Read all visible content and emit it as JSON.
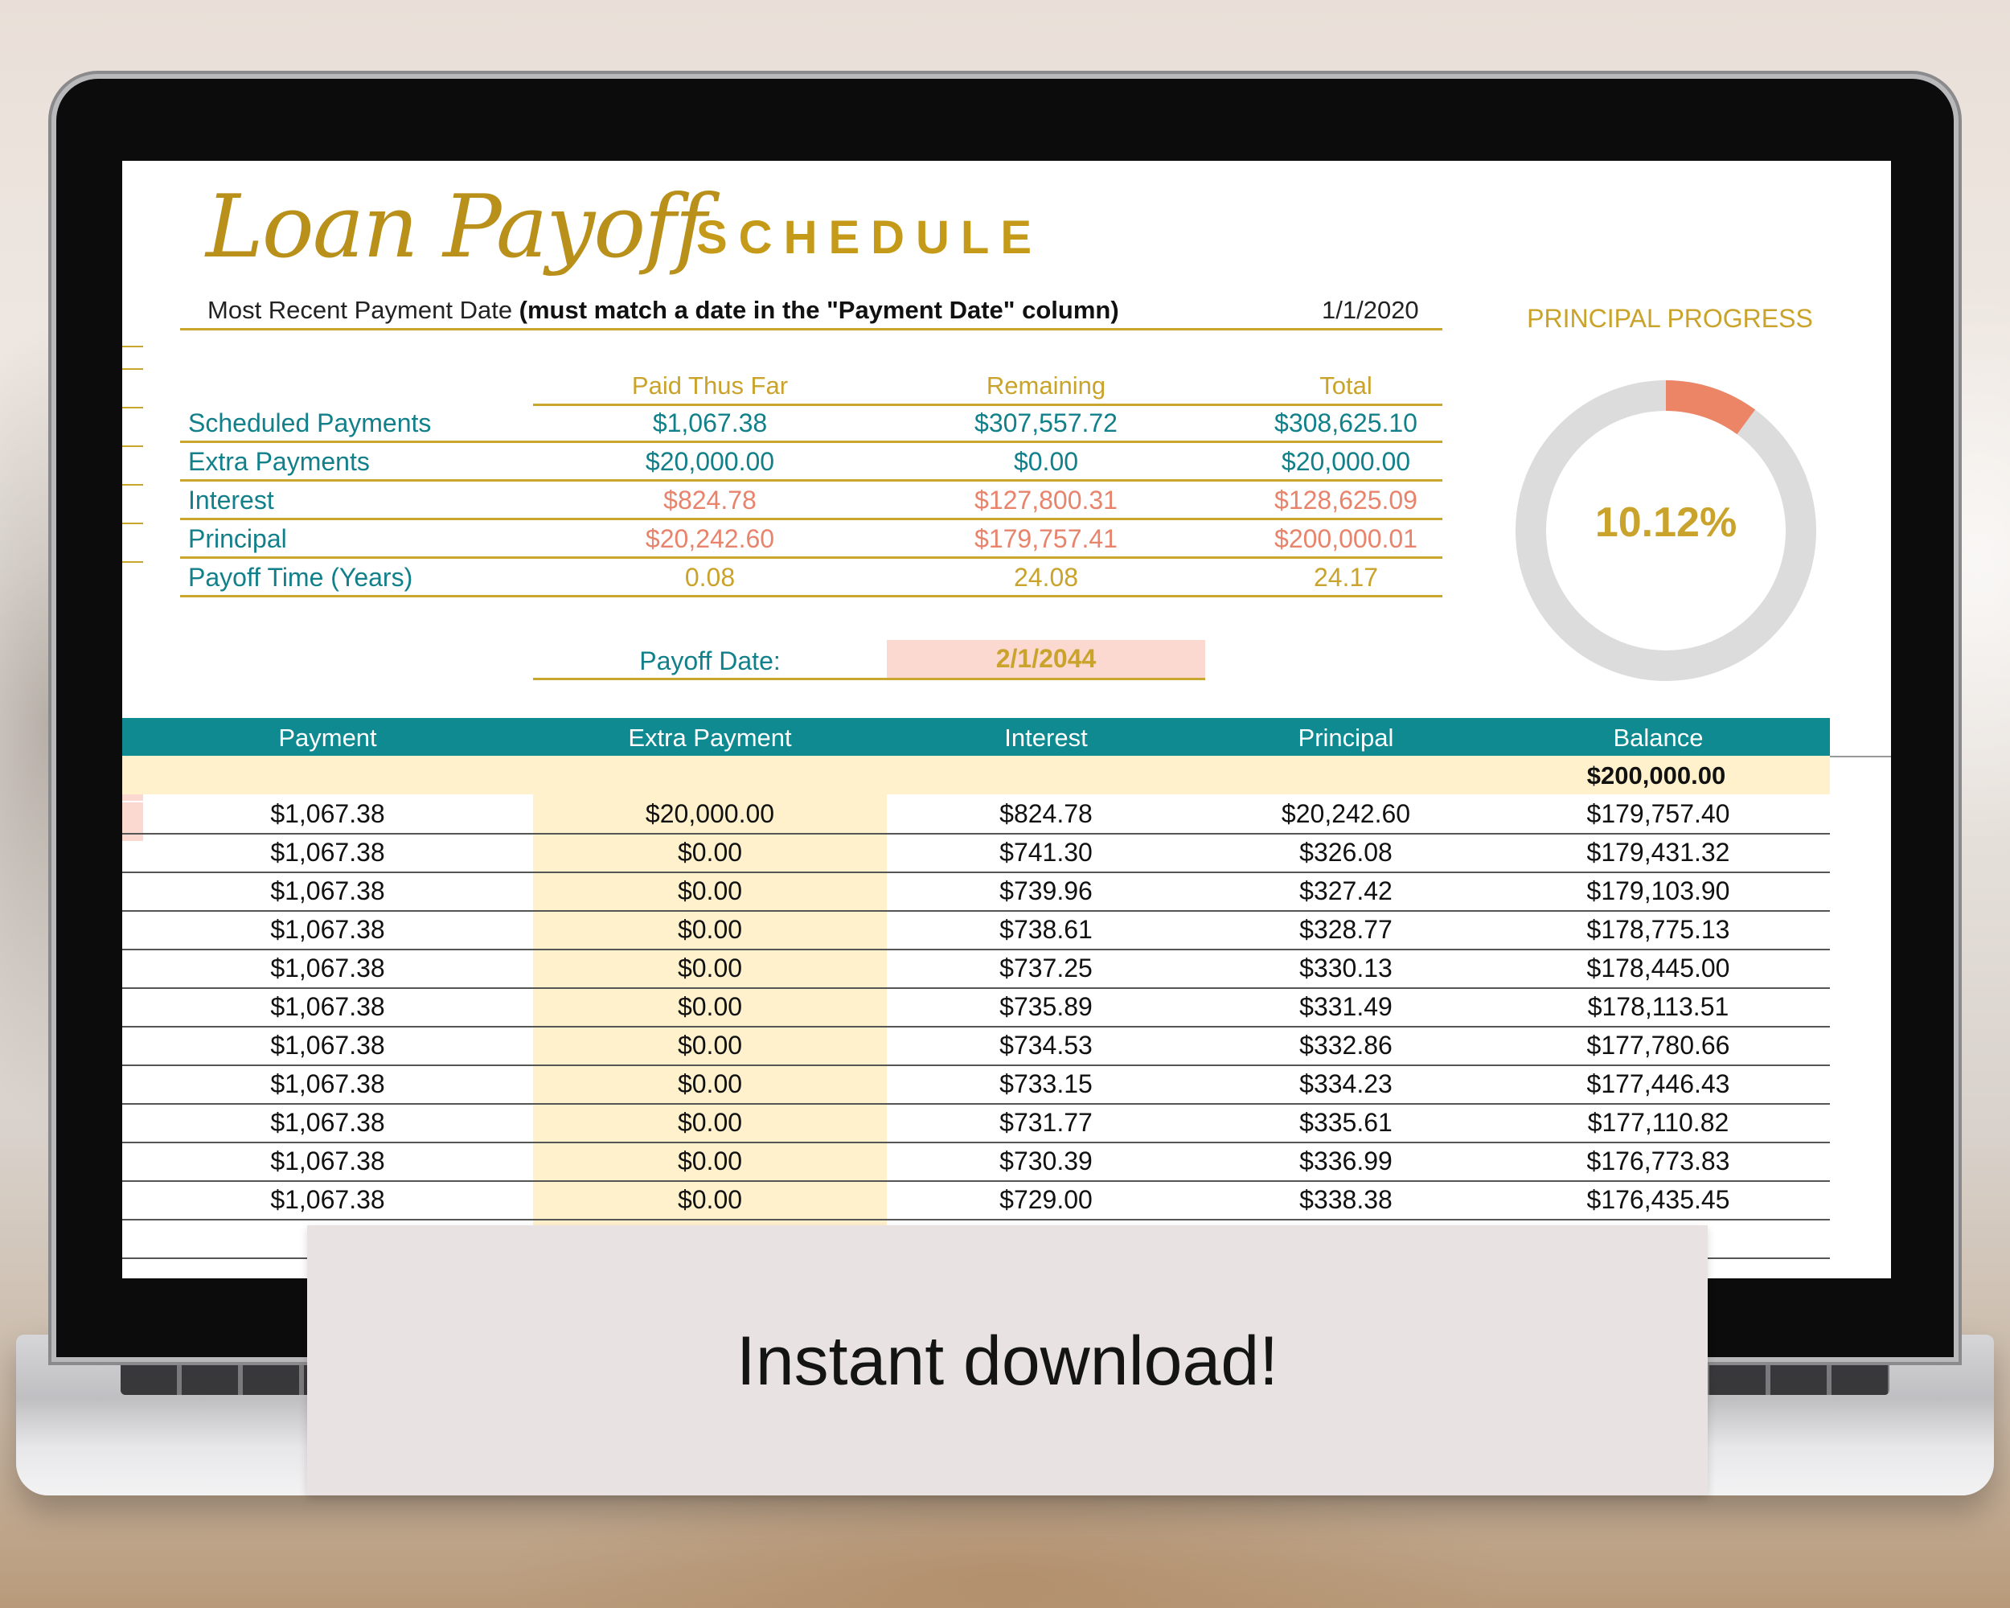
{
  "title": {
    "script": "Loan Payoff",
    "caps": "SCHEDULE"
  },
  "recent_payment": {
    "label": "Most Recent Payment Date ",
    "label_bold": "(must match a date in the \"Payment Date\" column)",
    "value": "1/1/2020"
  },
  "summary": {
    "headers": [
      "Paid Thus Far",
      "Remaining",
      "Total"
    ],
    "rows": [
      {
        "label": "Scheduled Payments",
        "values": [
          "$1,067.38",
          "$307,557.72",
          "$308,625.10"
        ],
        "color": "teal"
      },
      {
        "label": "Extra Payments",
        "values": [
          "$20,000.00",
          "$0.00",
          "$20,000.00"
        ],
        "color": "teal"
      },
      {
        "label": "Interest",
        "values": [
          "$824.78",
          "$127,800.31",
          "$128,625.09"
        ],
        "color": "salmon"
      },
      {
        "label": "Principal",
        "values": [
          "$20,242.60",
          "$179,757.41",
          "$200,000.01"
        ],
        "color": "salmon"
      },
      {
        "label": "Payoff Time (Years)",
        "values": [
          "0.08",
          "24.08",
          "24.17"
        ],
        "color": "gold"
      }
    ],
    "payoff_label": "Payoff Date:",
    "payoff_value": "2/1/2044"
  },
  "progress": {
    "title": "PRINCIPAL PROGRESS",
    "percent_label": "10.12%",
    "fraction": 0.1012,
    "colors": {
      "filled": "#ec8466",
      "track": "#dcdcdc"
    }
  },
  "table": {
    "headers": [
      "Payment",
      "Extra Payment",
      "Interest",
      "Principal",
      "Balance"
    ],
    "starting_balance": "$200,000.00",
    "rows": [
      [
        "$1,067.38",
        "$20,000.00",
        "$824.78",
        "$20,242.60",
        "$179,757.40"
      ],
      [
        "$1,067.38",
        "$0.00",
        "$741.30",
        "$326.08",
        "$179,431.32"
      ],
      [
        "$1,067.38",
        "$0.00",
        "$739.96",
        "$327.42",
        "$179,103.90"
      ],
      [
        "$1,067.38",
        "$0.00",
        "$738.61",
        "$328.77",
        "$178,775.13"
      ],
      [
        "$1,067.38",
        "$0.00",
        "$737.25",
        "$330.13",
        "$178,445.00"
      ],
      [
        "$1,067.38",
        "$0.00",
        "$735.89",
        "$331.49",
        "$178,113.51"
      ],
      [
        "$1,067.38",
        "$0.00",
        "$734.53",
        "$332.86",
        "$177,780.66"
      ],
      [
        "$1,067.38",
        "$0.00",
        "$733.15",
        "$334.23",
        "$177,446.43"
      ],
      [
        "$1,067.38",
        "$0.00",
        "$731.77",
        "$335.61",
        "$177,110.82"
      ],
      [
        "$1,067.38",
        "$0.00",
        "$730.39",
        "$336.99",
        "$176,773.83"
      ],
      [
        "$1,067.38",
        "$0.00",
        "$729.00",
        "$338.38",
        "$176,435.45"
      ],
      [
        "$",
        "",
        "",
        "",
        ""
      ]
    ]
  },
  "banner": {
    "text": "Instant download!"
  },
  "colors": {
    "teal": "#0f8a91",
    "gold": "#c49a18",
    "salmon": "#e8836c",
    "cream": "#fff1cc",
    "pink": "#fcd9d0"
  }
}
